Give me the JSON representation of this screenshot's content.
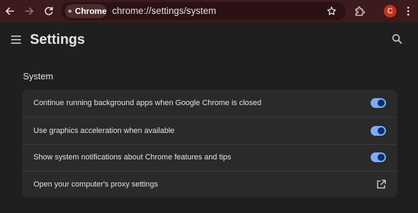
{
  "browser": {
    "chip_label": "Chrome",
    "url": "chrome://settings/system",
    "avatar_initial": "C",
    "avatar_color": "#c5321e",
    "toolbar_color": "#3c1a1d"
  },
  "header": {
    "title": "Settings"
  },
  "section": {
    "title": "System",
    "rows": [
      {
        "label": "Continue running background apps when Google Chrome is closed",
        "control": "toggle",
        "enabled": true
      },
      {
        "label": "Use graphics acceleration when available",
        "control": "toggle",
        "enabled": true
      },
      {
        "label": "Show system notifications about Chrome features and tips",
        "control": "toggle",
        "enabled": true
      },
      {
        "label": "Open your computer's proxy settings",
        "control": "external-link"
      }
    ]
  },
  "icons": [
    "back-icon",
    "forward-icon",
    "reload-icon",
    "chrome-logo-icon",
    "bookmark-star-icon",
    "extensions-icon",
    "hamburger-menu-icon",
    "search-icon",
    "external-link-icon"
  ],
  "colors": {
    "accent": "#7cacf8",
    "background": "#1f1f1f",
    "card": "#2a2a2a"
  }
}
